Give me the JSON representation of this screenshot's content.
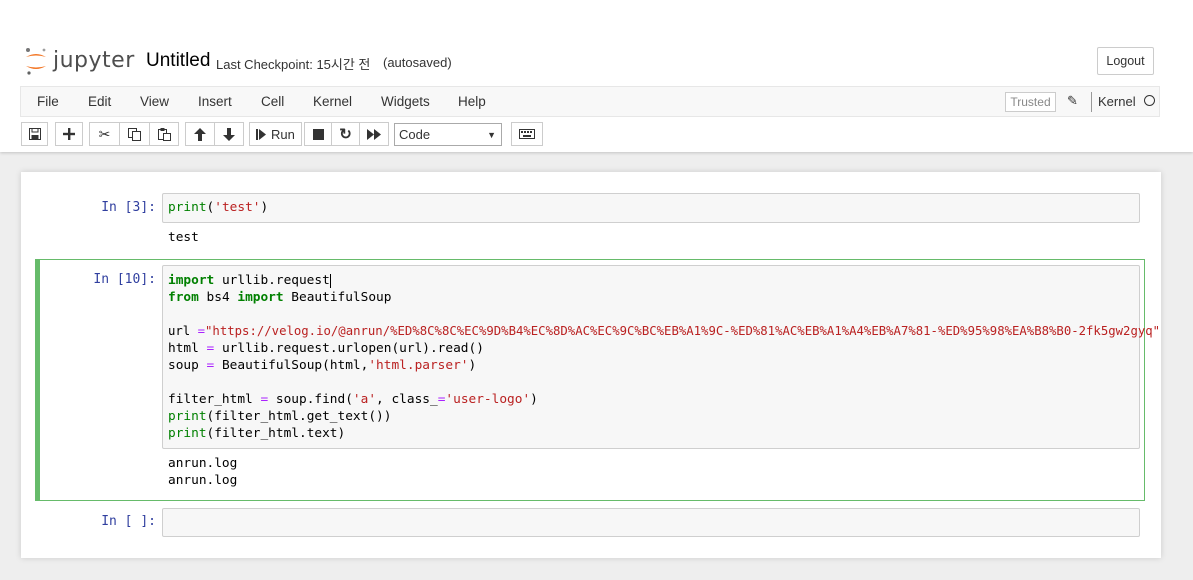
{
  "header": {
    "logo_text": "jupyter",
    "notebook_title": "Untitled",
    "checkpoint_text": "Last Checkpoint: 15시간 전",
    "autosave_text": "(autosaved)",
    "logout_label": "Logout"
  },
  "menubar": {
    "items": [
      "File",
      "Edit",
      "View",
      "Insert",
      "Cell",
      "Kernel",
      "Widgets",
      "Help"
    ],
    "trusted_label": "Trusted",
    "kernel_label": "Kernel"
  },
  "toolbar": {
    "run_label": "Run",
    "cell_type": "Code",
    "icons": [
      "save-icon",
      "plus-icon",
      "scissors-icon",
      "copy-icon",
      "paste-icon",
      "arrow-up-icon",
      "arrow-down-icon",
      "step-forward-icon",
      "stop-icon",
      "restart-icon",
      "fast-forward-icon",
      "keyboard-icon"
    ]
  },
  "cells": [
    {
      "prompt": "In [3]:",
      "code": {
        "l1_fn": "print",
        "l1_open": "(",
        "l1_str": "'test'",
        "l1_close": ")"
      },
      "output": [
        "test"
      ]
    },
    {
      "prompt": "In [10]:",
      "code": {
        "l1_kw": "import",
        "l1_rest": " urllib.request",
        "l2_kw1": "from",
        "l2_mid": " bs4 ",
        "l2_kw2": "import",
        "l2_rest": " BeautifulSoup",
        "l4_var": "url ",
        "l4_op": "=",
        "l4_str": "\"https://velog.io/@anrun/%ED%8C%8C%EC%9D%B4%EC%8D%AC%EC%9C%BC%EB%A1%9C-%ED%81%AC%EB%A1%A4%EB%A7%81-%ED%95%98%EA%B8%B0-2fk5gw2gyq\"",
        "l5_var": "html ",
        "l5_op": "=",
        "l5_rest": " urllib.request.urlopen(url).read()",
        "l6_var": "soup ",
        "l6_op": "=",
        "l6_rest": " BeautifulSoup(html,",
        "l6_str": "'html.parser'",
        "l6_close": ")",
        "l8_var": "filter_html ",
        "l8_op": "=",
        "l8_rest": " soup.find(",
        "l8_str1": "'a'",
        "l8_mid": ", class_",
        "l8_op2": "=",
        "l8_str2": "'user-logo'",
        "l8_close": ")",
        "l9_fn": "print",
        "l9_rest": "(filter_html.get_text())",
        "l10_fn": "print",
        "l10_rest": "(filter_html.text)"
      },
      "output": [
        "anrun.log",
        "anrun.log"
      ]
    },
    {
      "prompt": "In [ ]:"
    }
  ],
  "colors": {
    "selected_cell_border": "#66bb6a",
    "prompt_color": "#303f9f",
    "keyword": "#008000",
    "string": "#ba2121",
    "operator": "#aa22ff"
  }
}
